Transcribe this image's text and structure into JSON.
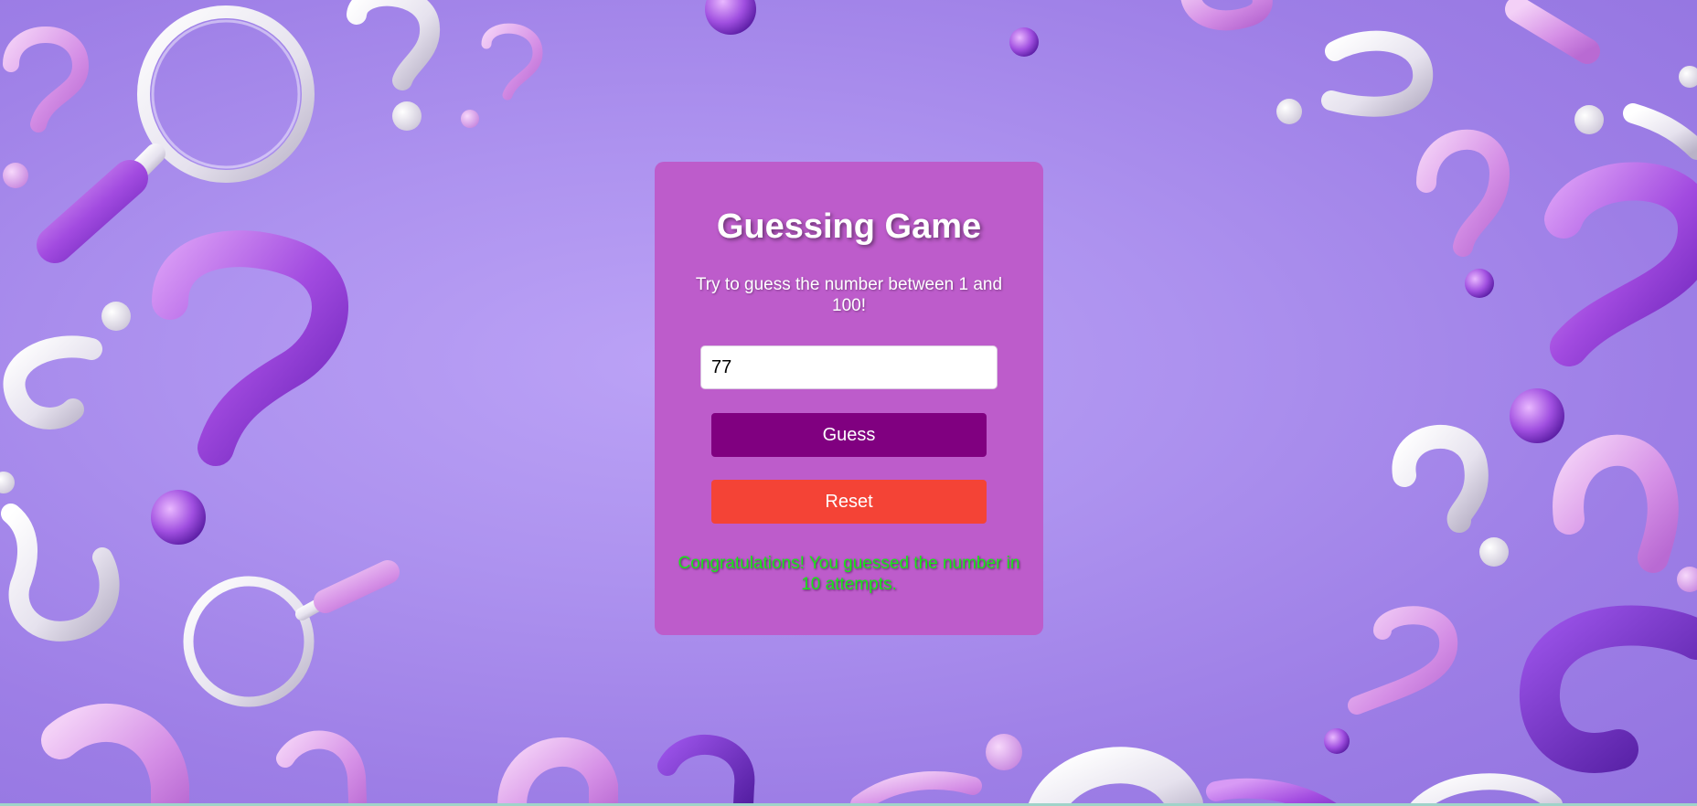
{
  "game": {
    "title": "Guessing Game",
    "instructions": "Try to guess the number between 1 and 100!",
    "input_value": "77",
    "guess_label": "Guess",
    "reset_label": "Reset",
    "result_message": "Congratulations! You guessed the number in 10 attempts."
  },
  "colors": {
    "card": "#bd5ccb",
    "guess_button": "#800080",
    "reset_button": "#f44336",
    "success_text": "#19e619",
    "background": "#b39af2"
  },
  "background_decor": {
    "icons": [
      "question-mark-icon",
      "magnifying-glass-icon",
      "sphere-icon"
    ]
  }
}
